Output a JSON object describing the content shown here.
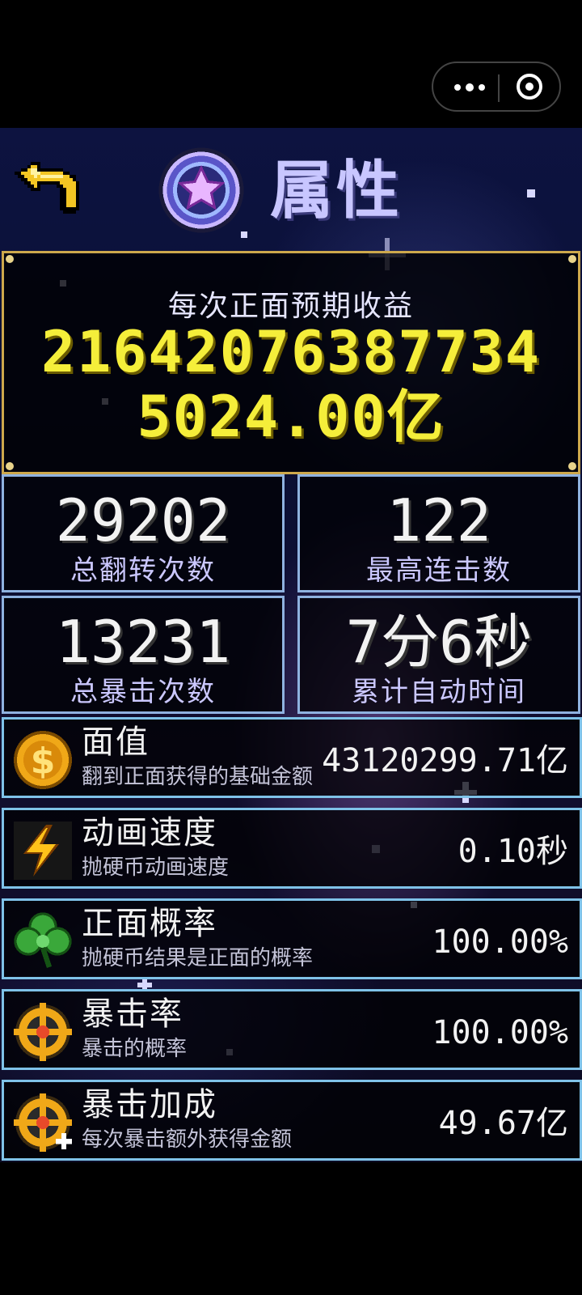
{
  "header": {
    "title": "属性"
  },
  "capsule": {
    "more_icon": "more-dots-icon",
    "close_icon": "target-close-icon"
  },
  "summary": {
    "label": "每次正面预期收益",
    "value_line1": "21642076387734",
    "value_line2": "5024.00亿"
  },
  "stats": [
    {
      "value": "29202",
      "label": "总翻转次数"
    },
    {
      "value": "122",
      "label": "最高连击数"
    },
    {
      "value": "13231",
      "label": "总暴击次数"
    },
    {
      "value": "7分6秒",
      "label": "累计自动时间"
    }
  ],
  "attributes": [
    {
      "name": "面值",
      "desc": "翻到正面获得的基础金额",
      "value": "43120299.71亿",
      "icon": "gold-coin-icon"
    },
    {
      "name": "动画速度",
      "desc": "抛硬币动画速度",
      "value": "0.10秒",
      "icon": "lightning-icon"
    },
    {
      "name": "正面概率",
      "desc": "抛硬币结果是正面的概率",
      "value": "100.00%",
      "icon": "clover-icon"
    },
    {
      "name": "暴击率",
      "desc": "暴击的概率",
      "value": "100.00%",
      "icon": "crosshair-icon"
    },
    {
      "name": "暴击加成",
      "desc": "每次暴击额外获得金额",
      "value": "49.67亿",
      "icon": "crosshair-plus-icon"
    }
  ],
  "colors": {
    "gold": "#f5ee3a",
    "title": "#c8c6ff",
    "panel_border": "#cda84c",
    "stat_border": "#8fb2e0"
  }
}
